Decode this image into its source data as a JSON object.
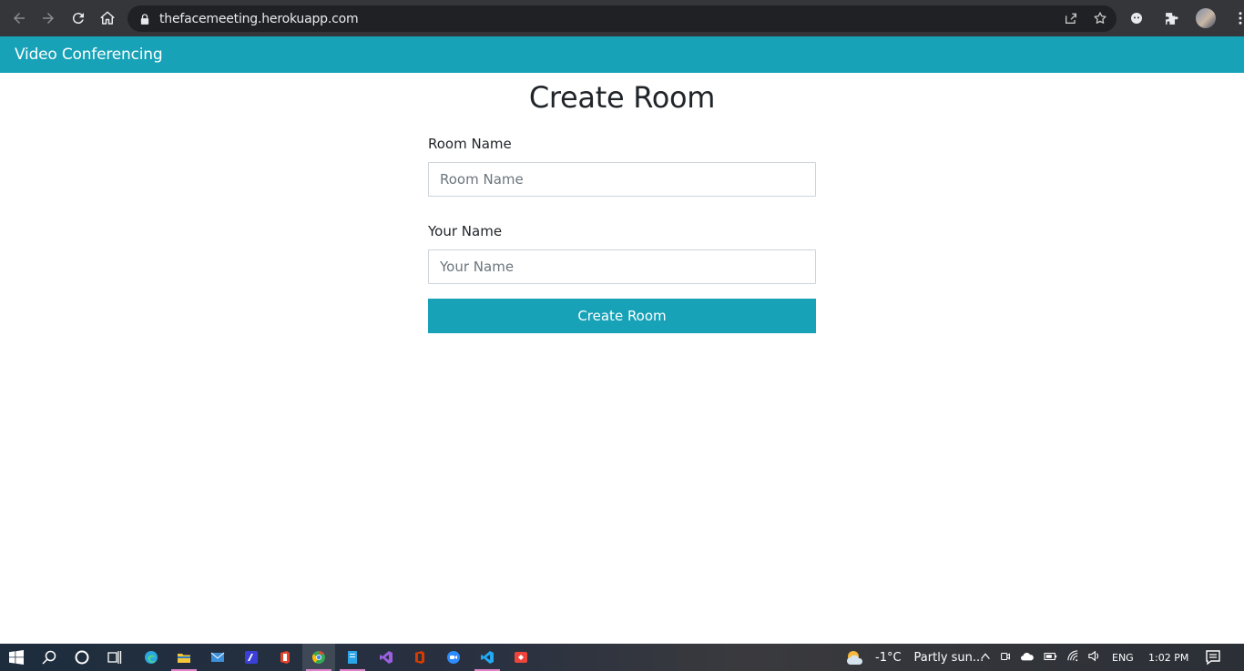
{
  "browser": {
    "url": "thefacemeeting.herokuapp.com"
  },
  "navbar": {
    "brand": "Video Conferencing"
  },
  "form": {
    "title": "Create Room",
    "room_label": "Room Name",
    "room_placeholder": "Room Name",
    "room_value": "",
    "name_label": "Your Name",
    "name_placeholder": "Your Name",
    "name_value": "",
    "submit_label": "Create Room"
  },
  "taskbar": {
    "weather_temp": "-1°C",
    "weather_desc": "Partly sun...",
    "language": "ENG",
    "time": "1:02 PM"
  },
  "colors": {
    "accent": "#17a2b8",
    "chrome_bg": "#35363a",
    "omnibox_bg": "#202124"
  }
}
